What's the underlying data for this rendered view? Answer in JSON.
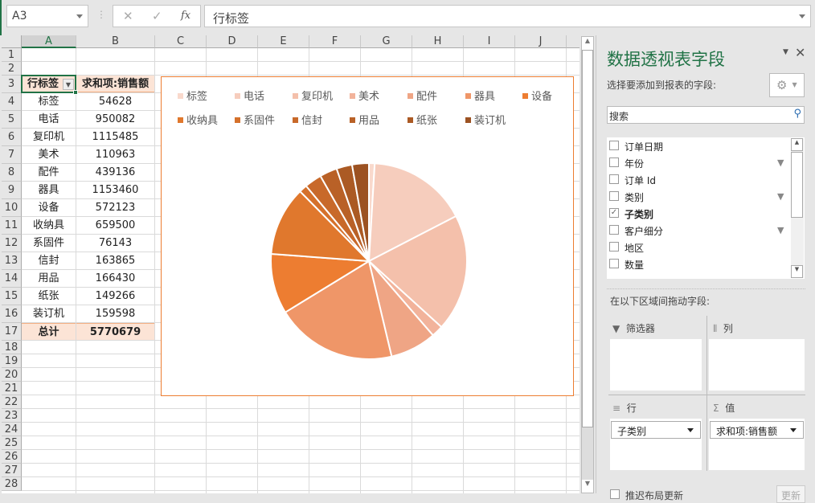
{
  "formula_bar": {
    "name_box": "A3",
    "cancel": "✕",
    "enter": "✓",
    "fx": "fx",
    "content": "行标签"
  },
  "columns": [
    "A",
    "B",
    "C",
    "D",
    "E",
    "F",
    "G",
    "H",
    "I",
    "J"
  ],
  "rows": [
    "1",
    "2",
    "3",
    "4",
    "5",
    "6",
    "7",
    "8",
    "9",
    "10",
    "11",
    "12",
    "13",
    "14",
    "15",
    "16",
    "17",
    "18",
    "19",
    "20",
    "21",
    "22",
    "23",
    "24",
    "25",
    "26",
    "27",
    "28"
  ],
  "pivot": {
    "header_row": "行标签",
    "header_value": "求和项:销售额",
    "items": [
      [
        "标签",
        "54628"
      ],
      [
        "电话",
        "950082"
      ],
      [
        "复印机",
        "1115485"
      ],
      [
        "美术",
        "110963"
      ],
      [
        "配件",
        "439136"
      ],
      [
        "器具",
        "1153460"
      ],
      [
        "设备",
        "572123"
      ],
      [
        "收纳具",
        "659500"
      ],
      [
        "系固件",
        "76143"
      ],
      [
        "信封",
        "163865"
      ],
      [
        "用品",
        "166430"
      ],
      [
        "纸张",
        "149266"
      ],
      [
        "装订机",
        "159598"
      ]
    ],
    "total_label": "总计",
    "total_value": "5770679"
  },
  "chart_data": {
    "type": "pie",
    "title": "",
    "legend": "top",
    "categories": [
      "标签",
      "电话",
      "复印机",
      "美术",
      "配件",
      "器具",
      "设备",
      "收纳具",
      "系固件",
      "信封",
      "用品",
      "纸张",
      "装订机"
    ],
    "values": [
      54628,
      950082,
      1115485,
      110963,
      439136,
      1153460,
      572123,
      659500,
      76143,
      163865,
      166430,
      149266,
      159598
    ],
    "colors": [
      "#f9d9cc",
      "#f6cdbd",
      "#f4c0ab",
      "#f2b39b",
      "#efa585",
      "#ef9668",
      "#ed7d31",
      "#e0782d",
      "#d5712b",
      "#c8692a",
      "#b96127",
      "#ab5a24",
      "#9c5222"
    ]
  },
  "pane": {
    "title": "数据透视表字段",
    "choose_label": "选择要添加到报表的字段:",
    "search_placeholder": "搜索",
    "fields": [
      {
        "label": "订单日期",
        "checked": false,
        "filter": false
      },
      {
        "label": "年份",
        "checked": false,
        "filter": true
      },
      {
        "label": "订单 Id",
        "checked": false,
        "filter": false
      },
      {
        "label": "类别",
        "checked": false,
        "filter": true
      },
      {
        "label": "子类别",
        "checked": true,
        "filter": false
      },
      {
        "label": "客户细分",
        "checked": false,
        "filter": true
      },
      {
        "label": "地区",
        "checked": false,
        "filter": false
      },
      {
        "label": "数量",
        "checked": false,
        "filter": false
      }
    ],
    "drag_label": "在以下区域间拖动字段:",
    "filters_label": "筛选器",
    "columns_label": "列",
    "rows_label": "行",
    "values_label": "值",
    "rows_item": "子类别",
    "values_item": "求和项:销售额",
    "defer_label": "推迟布局更新",
    "update_label": "更新"
  }
}
